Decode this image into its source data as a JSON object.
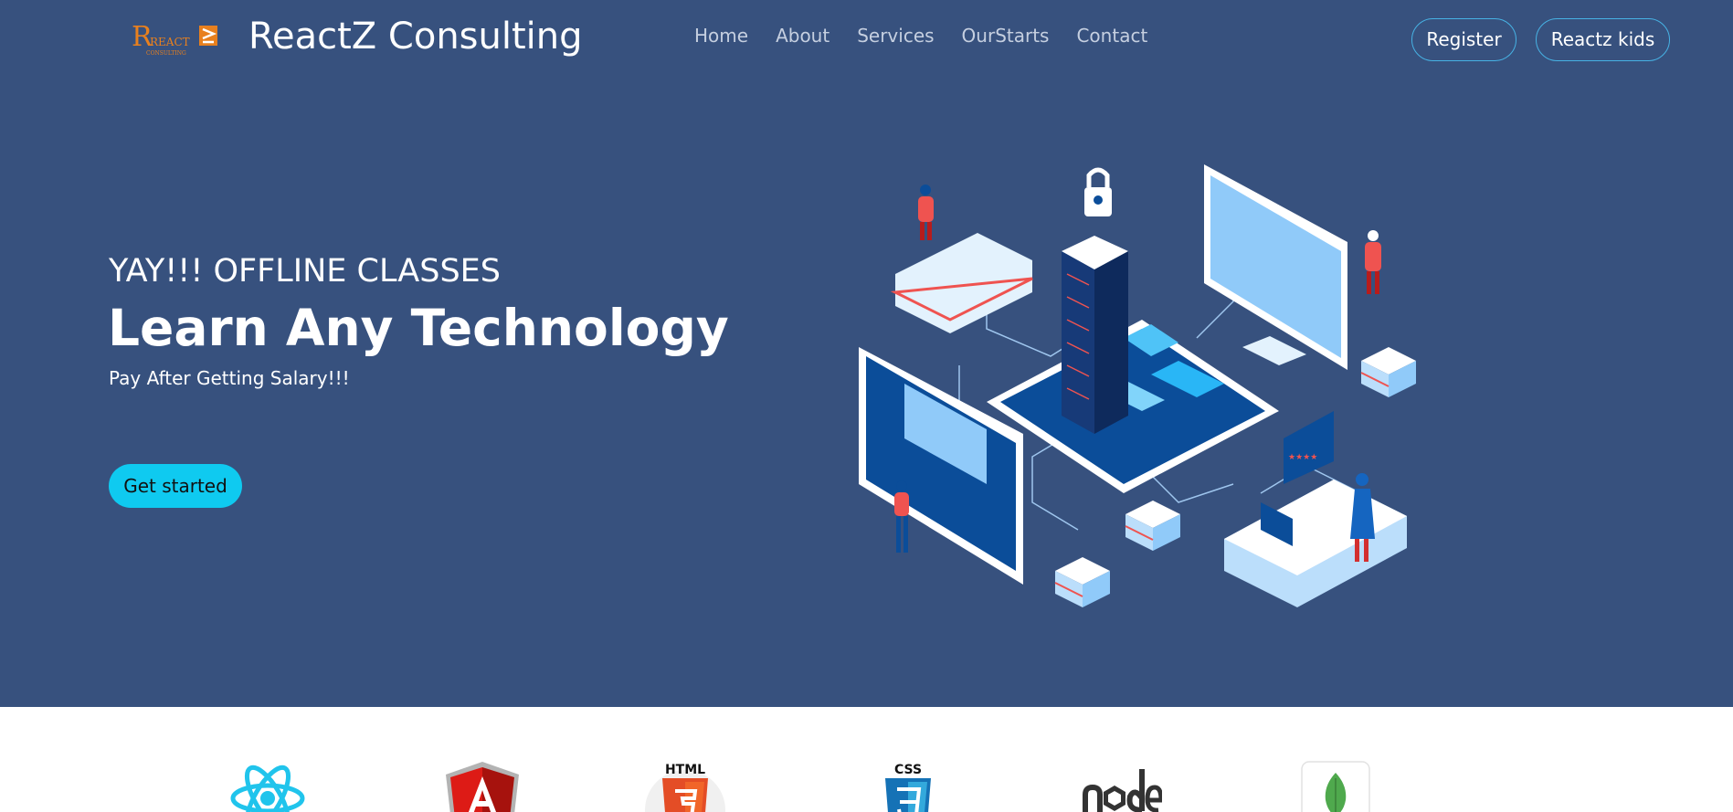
{
  "brand": {
    "logo_icon": "reactz-consulting-logo",
    "logo_text": "REACT",
    "logo_subtext": "CONSULTING",
    "name": "ReactZ Consulting"
  },
  "nav": {
    "items": [
      {
        "label": "Home"
      },
      {
        "label": "About"
      },
      {
        "label": "Services"
      },
      {
        "label": "OurStarts"
      },
      {
        "label": "Contact"
      }
    ]
  },
  "actions": {
    "register_label": "Register",
    "kids_label": "Reactz kids"
  },
  "hero": {
    "subtitle": "YAY!!! OFFLINE CLASSES",
    "title": "Learn Any Technology",
    "tagline": "Pay After Getting Salary!!!",
    "cta_label": "Get started",
    "illustration_icon": "isometric-technology-illustration"
  },
  "tech_logos": [
    {
      "icon": "react-logo-icon"
    },
    {
      "icon": "angular-logo-icon"
    },
    {
      "icon": "html5-logo-icon",
      "text": "HTML"
    },
    {
      "icon": "css3-logo-icon",
      "text": "CSS"
    },
    {
      "icon": "nodejs-logo-icon"
    },
    {
      "icon": "mongodb-logo-icon"
    }
  ],
  "colors": {
    "hero_background": "#37517e",
    "accent": "#47b2e4",
    "cta_background": "#0fcaf0",
    "logo_orange": "#e8801e"
  }
}
